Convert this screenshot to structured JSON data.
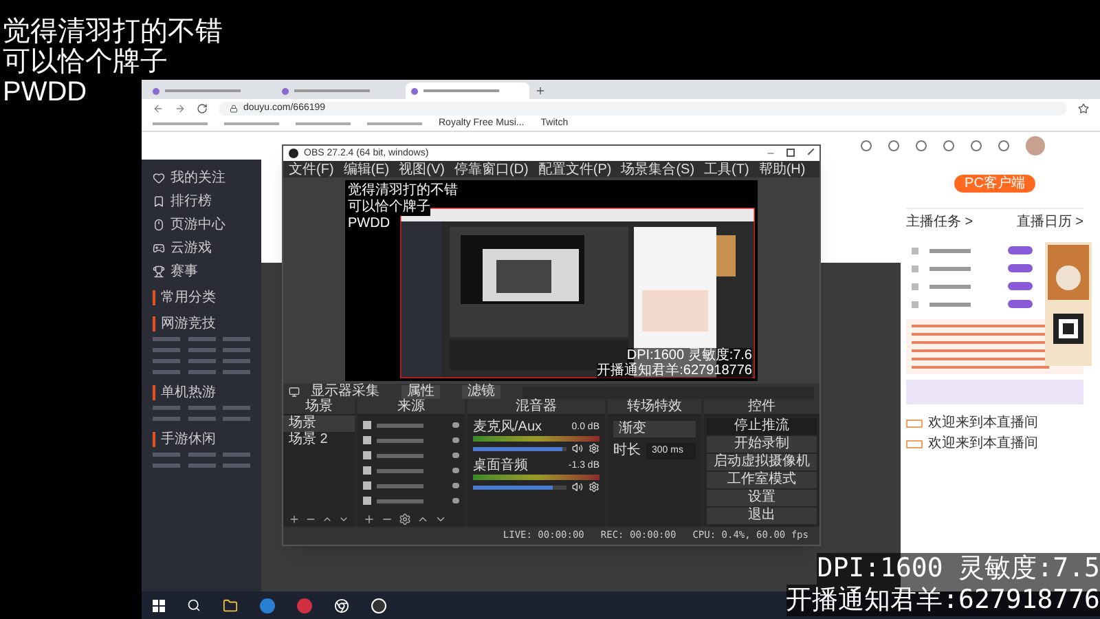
{
  "overlay": {
    "lines": [
      "觉得清羽打的不错",
      "可以恰个牌子",
      "PWDD"
    ],
    "stats": [
      "DPI:1600 灵敏度:7.5",
      "开播通知君羊:627918776"
    ]
  },
  "browser": {
    "tabs": [
      {
        "selected": false
      },
      {
        "selected": false
      },
      {
        "selected": true
      }
    ],
    "url": "douyu.com/666199",
    "bookmarks": [
      "Royalty Free Musi...",
      "Twitch"
    ]
  },
  "site": {
    "nav": [
      "我的关注",
      "排行榜",
      "页游中心",
      "云游戏",
      "赛事"
    ],
    "sections": [
      "常用分类",
      "网游竞技",
      "单机热游",
      "手游休闲"
    ],
    "client_button": "PC客户端",
    "links": [
      "主播任务 >",
      "直播日历 >"
    ],
    "chat": [
      "欢迎来到本直播间",
      "欢迎来到本直播间"
    ]
  },
  "obs": {
    "title": "OBS 27.2.4 (64 bit, windows)",
    "menu": [
      "文件(F)",
      "编辑(E)",
      "视图(V)",
      "停靠窗口(D)",
      "配置文件(P)",
      "场景集合(S)",
      "工具(T)",
      "帮助(H)"
    ],
    "preview_lines": [
      "觉得清羽打的不错",
      "可以恰个牌子",
      "PWDD"
    ],
    "preview_stats": [
      "DPI:1600 灵敏度:7.6",
      "开播通知君羊:627918776"
    ],
    "source_name": "显示器采集",
    "toolbar": [
      "属性",
      "滤镜"
    ],
    "docks": [
      "场景",
      "来源",
      "混音器",
      "转场特效",
      "控件"
    ],
    "scenes": [
      {
        "label": "场景",
        "selected": true
      },
      {
        "label": "场景 2",
        "selected": false
      }
    ],
    "mixer": [
      {
        "name": "麦克风/Aux",
        "reading": "0.0 dB",
        "level": 0.95
      },
      {
        "name": "桌面音频",
        "reading": "-1.3 dB",
        "level": 0.85
      }
    ],
    "transition": {
      "name": "渐变",
      "duration_label": "时长",
      "duration": "300 ms"
    },
    "controls": [
      "停止推流",
      "开始录制",
      "启动虚拟摄像机",
      "工作室模式",
      "设置",
      "退出"
    ],
    "status": [
      "LIVE: 00:00:00",
      "REC: 00:00:00",
      "CPU: 0.4%, 60.00 fps"
    ]
  }
}
